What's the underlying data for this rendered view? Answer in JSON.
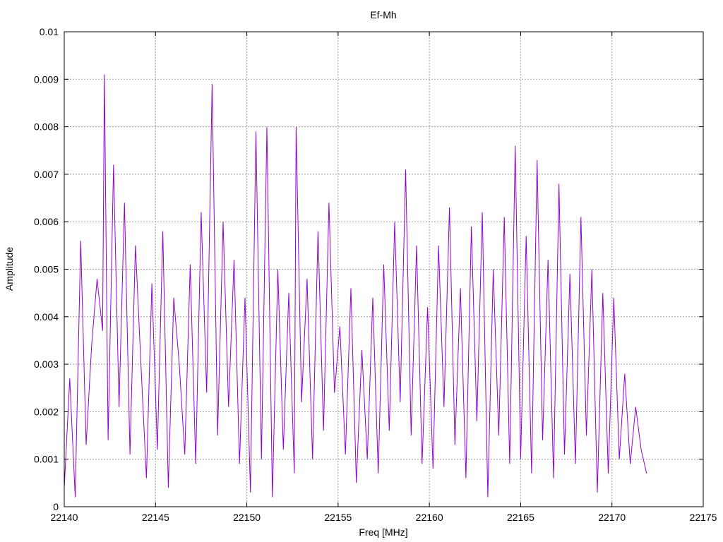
{
  "chart_data": {
    "type": "line",
    "title": "Ef-Mh",
    "xlabel": "Freq [MHz]",
    "ylabel": "Amplitude",
    "xlim": [
      22140,
      22175
    ],
    "ylim": [
      0,
      0.01
    ],
    "x_ticks": [
      "22140",
      "22145",
      "22150",
      "22155",
      "22160",
      "22165",
      "22170",
      "22175"
    ],
    "y_ticks": [
      "0",
      "0.001",
      "0.002",
      "0.003",
      "0.004",
      "0.005",
      "0.006",
      "0.007",
      "0.008",
      "0.009",
      "0.01"
    ],
    "grid": true,
    "series_color": "#9400d3",
    "series": [
      {
        "x": [
          22140.0,
          22140.3,
          22140.6,
          22140.9,
          22141.2,
          22141.5,
          22141.8,
          22142.1,
          22142.2,
          22142.4,
          22142.7,
          22143.0,
          22143.3,
          22143.6,
          22143.9,
          22144.2,
          22144.5,
          22144.8,
          22145.1,
          22145.4,
          22145.7,
          22146.0,
          22146.3,
          22146.6,
          22146.9,
          22147.2,
          22147.5,
          22147.8,
          22148.1,
          22148.4,
          22148.7,
          22149.0,
          22149.3,
          22149.6,
          22149.9,
          22150.2,
          22150.5,
          22150.8,
          22151.1,
          22151.4,
          22151.7,
          22152.0,
          22152.3,
          22152.6,
          22152.7,
          22153.0,
          22153.3,
          22153.6,
          22153.9,
          22154.2,
          22154.5,
          22154.8,
          22155.1,
          22155.4,
          22155.7,
          22156.0,
          22156.3,
          22156.6,
          22156.9,
          22157.2,
          22157.5,
          22157.8,
          22158.1,
          22158.4,
          22158.7,
          22159.0,
          22159.3,
          22159.6,
          22159.9,
          22160.2,
          22160.5,
          22160.8,
          22161.1,
          22161.4,
          22161.7,
          22162.0,
          22162.3,
          22162.6,
          22162.9,
          22163.2,
          22163.5,
          22163.8,
          22164.1,
          22164.4,
          22164.7,
          22165.0,
          22165.3,
          22165.6,
          22165.9,
          22166.2,
          22166.5,
          22166.8,
          22167.1,
          22167.4,
          22167.7,
          22168.0,
          22168.3,
          22168.6,
          22168.9,
          22169.2,
          22169.5,
          22169.8,
          22170.1,
          22170.4,
          22170.7,
          22171.0,
          22171.3,
          22171.6,
          22171.9
        ],
        "values": [
          0.0004,
          0.0027,
          0.0002,
          0.0056,
          0.0013,
          0.0034,
          0.0048,
          0.0037,
          0.0091,
          0.0014,
          0.0072,
          0.0021,
          0.0064,
          0.0011,
          0.0055,
          0.003,
          0.0006,
          0.0047,
          0.0012,
          0.0058,
          0.0004,
          0.0044,
          0.003,
          0.0011,
          0.0051,
          0.0009,
          0.0062,
          0.0024,
          0.0089,
          0.0015,
          0.006,
          0.0021,
          0.0052,
          0.0009,
          0.0044,
          0.0003,
          0.0079,
          0.001,
          0.008,
          0.0002,
          0.005,
          0.0012,
          0.0045,
          0.0007,
          0.008,
          0.0022,
          0.0048,
          0.001,
          0.0058,
          0.0016,
          0.0064,
          0.0024,
          0.0038,
          0.0011,
          0.0046,
          0.0005,
          0.0033,
          0.001,
          0.0044,
          0.0007,
          0.0051,
          0.0016,
          0.006,
          0.0022,
          0.0071,
          0.0015,
          0.0055,
          0.0009,
          0.0042,
          0.0008,
          0.0055,
          0.0021,
          0.0063,
          0.0013,
          0.0046,
          0.0006,
          0.0059,
          0.0018,
          0.0062,
          0.0002,
          0.005,
          0.0015,
          0.0061,
          0.0009,
          0.0076,
          0.001,
          0.0057,
          0.0007,
          0.0073,
          0.0014,
          0.0052,
          0.0006,
          0.0068,
          0.0011,
          0.0049,
          0.0009,
          0.0061,
          0.0015,
          0.005,
          0.0003,
          0.0045,
          0.0007,
          0.0044,
          0.001,
          0.0028,
          0.0009,
          0.0021,
          0.0012,
          0.0007
        ]
      }
    ]
  }
}
